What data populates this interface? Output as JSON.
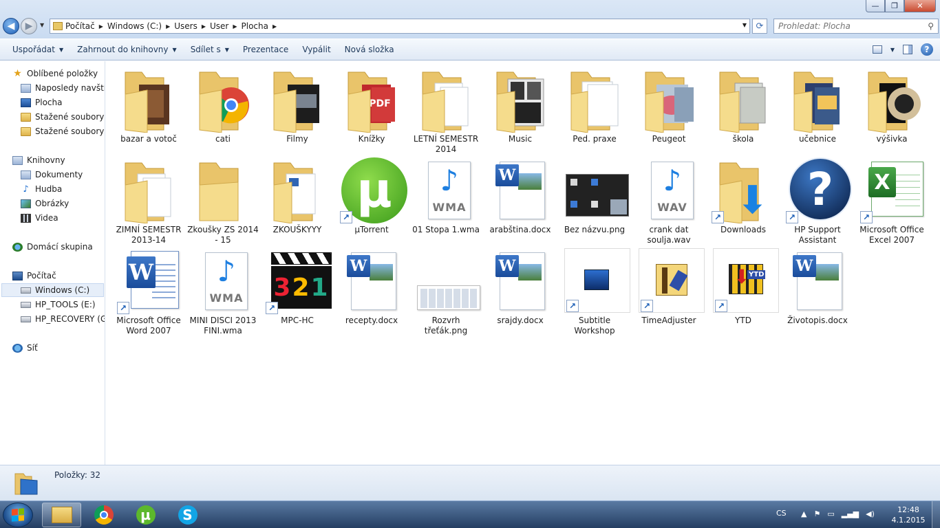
{
  "window": {
    "buttons": {
      "minimize": "—",
      "maximize": "❐",
      "close": "✕"
    }
  },
  "address": {
    "crumbs": [
      "Počítač",
      "Windows (C:)",
      "Users",
      "User",
      "Plocha"
    ]
  },
  "search": {
    "placeholder": "Prohledat: Plocha"
  },
  "toolbar": {
    "organize": "Uspořádat",
    "include_library": "Zahrnout do knihovny",
    "share": "Sdílet s",
    "slideshow": "Prezentace",
    "burn": "Vypálit",
    "new_folder": "Nová složka"
  },
  "nav": {
    "favorites": "Oblíbené položky",
    "recent": "Naposledy navštívené",
    "desktop": "Plocha",
    "downloads1": "Stažené soubory",
    "downloads2": "Stažené soubory",
    "libraries": "Knihovny",
    "documents": "Dokumenty",
    "music": "Hudba",
    "pictures": "Obrázky",
    "videos": "Videa",
    "homegroup": "Domácí skupina",
    "computer": "Počítač",
    "drive_c": "Windows (C:)",
    "drive_e": "HP_TOOLS (E:)",
    "drive_g": "HP_RECOVERY (G:)",
    "network": "Síť"
  },
  "files": [
    {
      "name": "bazar a votoč"
    },
    {
      "name": "cati"
    },
    {
      "name": "Filmy"
    },
    {
      "name": "Knížky"
    },
    {
      "name": "LETNÍ SEMESTR 2014"
    },
    {
      "name": "Music"
    },
    {
      "name": "Ped. praxe"
    },
    {
      "name": "Peugeot"
    },
    {
      "name": "škola"
    },
    {
      "name": "učebnice"
    },
    {
      "name": "výšivka"
    },
    {
      "name": "ZIMNÍ SEMESTR 2013-14"
    },
    {
      "name": "Zkoušky ZS 2014 - 15"
    },
    {
      "name": "ZKOUŠKYYY"
    },
    {
      "name": "µTorrent"
    },
    {
      "name": "01 Stopa 1.wma"
    },
    {
      "name": "arabština.docx"
    },
    {
      "name": "Bez názvu.png"
    },
    {
      "name": "crank dat soulja.wav"
    },
    {
      "name": "Downloads"
    },
    {
      "name": "HP Support Assistant"
    },
    {
      "name": "Microsoft Office Excel 2007"
    },
    {
      "name": "Microsoft Office Word 2007"
    },
    {
      "name": "MINI DISCI 2013 FINI.wma"
    },
    {
      "name": "MPC-HC"
    },
    {
      "name": "recepty.docx"
    },
    {
      "name": "Rozvrh třeťák.png"
    },
    {
      "name": "srajdy.docx"
    },
    {
      "name": "Subtitle Workshop"
    },
    {
      "name": "TimeAdjuster"
    },
    {
      "name": "YTD"
    },
    {
      "name": "Životopis.docx"
    }
  ],
  "thumb_text": {
    "pdf": "PDF",
    "wma": "WMA",
    "wav": "WAV",
    "word": "W",
    "excel": "X",
    "help": "?",
    "mpc": "321",
    "ytd": "YTD",
    "utorrent": "µ",
    "arrow": "⬇",
    "chrome": "◉",
    "shortcut": "↗",
    "note": "♪"
  },
  "details": {
    "count": "Položky: 32"
  },
  "taskbar": {
    "lang": "CS",
    "time": "12:48",
    "date": "4.1.2015"
  },
  "colors": {
    "folder": "#f2d378",
    "word": "#1f5fb6",
    "excel": "#2e8b37",
    "pdf": "#c0282d"
  }
}
